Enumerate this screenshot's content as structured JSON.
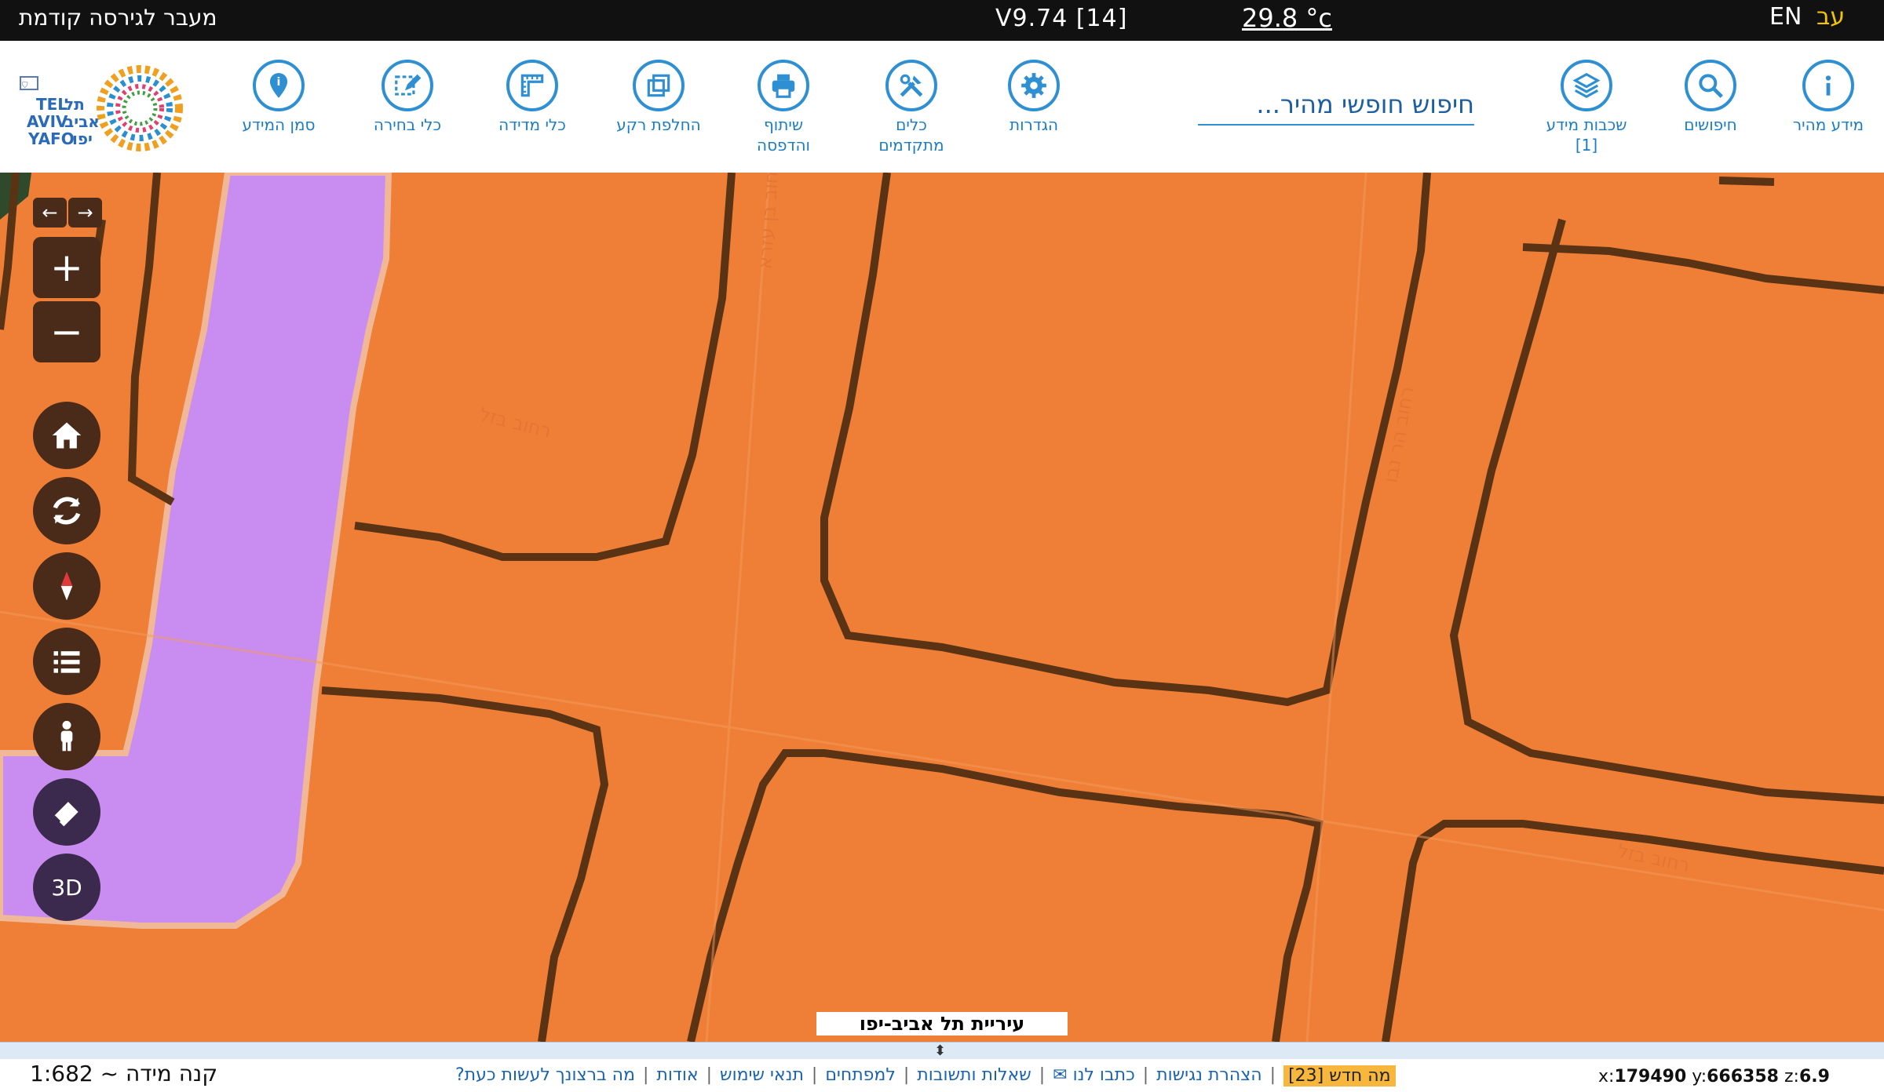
{
  "topbar": {
    "prev_version": "מעבר לגירסה קודמת",
    "version": "V9.74 [14]",
    "temperature": "29.8 °c",
    "lang_en": "EN",
    "lang_he": "עב"
  },
  "toolbar": {
    "logo_text": "TEL AVIV YAFO תל אביב יפו",
    "search_placeholder": "חיפוש חופשי מהיר...",
    "tools": [
      {
        "label": "סמן המידע",
        "icon": "info-pin-icon"
      },
      {
        "label": "כלי בחירה",
        "icon": "select-edit-icon"
      },
      {
        "label": "כלי מדידה",
        "icon": "measure-ruler-icon"
      },
      {
        "label": "החלפת רקע",
        "icon": "basemap-icon"
      },
      {
        "label": "שיתוף\nוהדפסה",
        "icon": "printer-icon"
      },
      {
        "label": "כלים\nמתקדמים",
        "icon": "tools-icon"
      },
      {
        "label": "הגדרות",
        "icon": "settings-gear-icon"
      },
      {
        "label": "שכבות מידע\n[1]",
        "icon": "layers-icon"
      },
      {
        "label": "חיפושים",
        "icon": "search-icon"
      },
      {
        "label": "מידע מהיר",
        "icon": "info-icon"
      }
    ]
  },
  "map": {
    "streets": [
      "רחוב בזל",
      "רחוב בזל",
      "רחוב הר נבו",
      "רחוב בן עזרא"
    ],
    "city_label": "עיריית תל אביב-יפו",
    "controls": {
      "zoom_in": "+",
      "zoom_out": "−",
      "back": "←",
      "forward": "→",
      "btn_3d": "3D"
    },
    "colors": {
      "block_fill": "#ef7f36",
      "border": "#5a3214",
      "park_fill": "#c98cf0"
    }
  },
  "bottombar": {
    "scale": "קנה מידה ~ 1:682",
    "links": [
      "מה ברצונך לעשות כעת?",
      "אודות",
      "תנאי שימוש",
      "למפתחים",
      "שאלות ותשובות",
      "כתבו לנו ✉",
      "הצהרת נגישות"
    ],
    "whats_new": "מה חדש [23]",
    "coords": {
      "x": "179490",
      "y": "666358",
      "z": "6.9"
    }
  }
}
